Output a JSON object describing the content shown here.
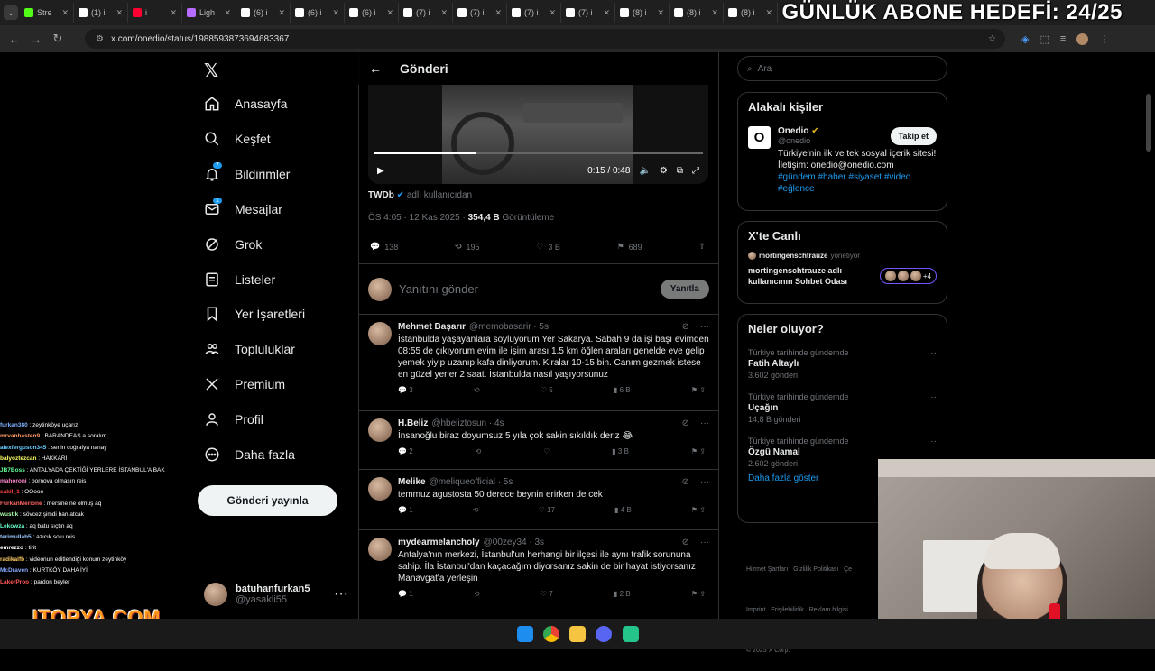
{
  "tabs": [
    {
      "label": "Stre",
      "color": "#53fc18"
    },
    {
      "label": "(1) i",
      "color": "#ffffff"
    },
    {
      "label": "i",
      "color": "#ff0033"
    },
    {
      "label": "Ligh",
      "color": "#b86bff"
    },
    {
      "label": "(6) i",
      "color": "#ffffff"
    },
    {
      "label": "(6) i",
      "color": "#ffffff"
    },
    {
      "label": "(6) i",
      "color": "#ffffff"
    },
    {
      "label": "(7) i",
      "color": "#ffffff"
    },
    {
      "label": "(7) i",
      "color": "#ffffff"
    },
    {
      "label": "(7) i",
      "color": "#ffffff"
    },
    {
      "label": "(7) i",
      "color": "#ffffff"
    },
    {
      "label": "(8) i",
      "color": "#ffffff"
    },
    {
      "label": "(8) i",
      "color": "#ffffff"
    },
    {
      "label": "(8) i",
      "color": "#ffffff"
    }
  ],
  "overlay": {
    "abone": "GÜNLÜK ABONE HEDEFİ: 24/25",
    "logo": "ITOPYA.COM"
  },
  "browser": {
    "url": "x.com/onedio/status/1988593873694683367"
  },
  "sidebar": {
    "items": [
      {
        "label": "Anasayfa",
        "icon": "home-icon"
      },
      {
        "label": "Keşfet",
        "icon": "search-icon"
      },
      {
        "label": "Bildirimler",
        "icon": "bell-icon",
        "badge": "7"
      },
      {
        "label": "Mesajlar",
        "icon": "mail-icon",
        "badge": "1"
      },
      {
        "label": "Grok",
        "icon": "grok-icon"
      },
      {
        "label": "Listeler",
        "icon": "list-icon"
      },
      {
        "label": "Yer İşaretleri",
        "icon": "bookmark-icon"
      },
      {
        "label": "Topluluklar",
        "icon": "people-icon"
      },
      {
        "label": "Premium",
        "icon": "x-icon"
      },
      {
        "label": "Profil",
        "icon": "person-icon"
      },
      {
        "label": "Daha fazla",
        "icon": "more-icon"
      }
    ],
    "post_button": "Gönderi yayınla",
    "user": {
      "name": "batuhanfurkan5",
      "handle": "@yasakli55",
      "more": "···"
    }
  },
  "main": {
    "header": "Gönderi",
    "video": {
      "time": "0:15 / 0:48"
    },
    "source": {
      "name": "TWDb",
      "suffix": "adlı kullanıcıdan"
    },
    "meta": {
      "time": "ÖS 4:05 · 12 Kas 2025 ·",
      "views": "354,4 B",
      "views_label": "Görüntüleme"
    },
    "stats": {
      "replies": "138",
      "retweets": "195",
      "likes": "3 B",
      "bookmarks": "689"
    },
    "reply_placeholder": "Yanıtını gönder",
    "reply_button": "Yanıtla",
    "tweets": [
      {
        "name": "Mehmet Başarır",
        "handle": "@memobasarir · 5s",
        "text": "İstanbulda yaşayanlara söylüyorum Yer Sakarya. Sabah 9 da işi başı evimden 08:55 de çıkıyorum evim ile işim arası 1.5 km öğlen araları genelde eve gelip yemek yiyip uzanıp kafa dinliyorum. Kiralar 10-15 bin. Canım gezmek istese en güzel yerler 2 saat. İstanbulda nasıl yaşıyorsunuz",
        "replies": "3",
        "retweets": "",
        "likes": "5",
        "views": "6 B"
      },
      {
        "name": "H.Beliz",
        "handle": "@hbeliztosun · 4s",
        "text": "İnsanoğlu biraz doyumsuz 5 yıla çok sakin sıkıldık deriz 😂",
        "replies": "2",
        "retweets": "",
        "likes": "",
        "views": "3 B"
      },
      {
        "name": "Melike",
        "handle": "@meliqueofficial · 5s",
        "text": "temmuz agustosta 50 derece beynin erirken de cek",
        "replies": "1",
        "retweets": "",
        "likes": "17",
        "views": "4 B"
      },
      {
        "name": "mydearmelancholy",
        "handle": "@00zey34 · 3s",
        "text": "Antalya'nın merkezi, İstanbul'un herhangi bir ilçesi ile aynı trafik sorununa sahip. İla İstanbul'dan kaçacağım diyorsanız sakin de bir hayat istiyorsanız Manavgat'a yerleşin",
        "replies": "1",
        "retweets": "",
        "likes": "7",
        "views": "2 B"
      }
    ]
  },
  "right": {
    "search_placeholder": "Ara",
    "related": {
      "title": "Alakalı kişiler",
      "name": "Onedio",
      "handle": "@onedio",
      "follow": "Takip et",
      "bio": "Türkiye'nin ilk ve tek sosyal içerik sitesi! İletişim: onedio@onedio.com",
      "tags": "#gündem #haber #siyaset #video #eğlence"
    },
    "live": {
      "title": "X'te Canlı",
      "host": "mortingenschtrauze",
      "host_suffix": "yönetiyor",
      "room": "mortingenschtrauze adlı kullanıcının Sohbet Odası",
      "count": "+4"
    },
    "trends": {
      "title": "Neler oluyor?",
      "items": [
        {
          "sub": "Türkiye tarihinde gündemde",
          "name": "Fatih Altaylı",
          "count": "3.602 gönderi"
        },
        {
          "sub": "Türkiye tarihinde gündemde",
          "name": "Uçağın",
          "count": "14,8 B gönderi"
        },
        {
          "sub": "Türkiye tarihinde gündemde",
          "name": "Özgü Namal",
          "count": "2.602 gönderi"
        }
      ],
      "more": "Daha fazla göster"
    },
    "footer": {
      "line1": "Hizmet Şartları   Gizlilik Politikası   Çe",
      "line2": "Imprint   Erişilebilirlik   Reklam bilgisi",
      "line3": "© 2025 X Corp."
    }
  },
  "chat": [
    {
      "user": "furkan380",
      "color": "#7fb3ff",
      "msg": "zeytinköye uçarız"
    },
    {
      "user": "mrvanbasten9",
      "color": "#ff9966",
      "msg": "BARANDEAŞ a soralım"
    },
    {
      "user": "alexferguson345",
      "color": "#66ccff",
      "msg": "senin coğrafya nanay"
    },
    {
      "user": "balyoztezcan",
      "color": "#ffff66",
      "msg": "HAKKARİ"
    },
    {
      "user": "JB7Boss",
      "color": "#66ff99",
      "msg": "ANTALYADA ÇEKTİĞİ YERLERE İSTANBUL'A BAK"
    },
    {
      "user": "mahoroni",
      "color": "#ff88cc",
      "msg": "bornova olmasın reis"
    },
    {
      "user": "sakil_1",
      "color": "#ff4444",
      "msg": "OOooo"
    },
    {
      "user": "FurkanMerione",
      "color": "#ff6666",
      "msg": "mersine ne olmuş aq"
    },
    {
      "user": "wustik",
      "color": "#aaffaa",
      "msg": "sövcez şimdi ban atcak"
    },
    {
      "user": "Lekowza",
      "color": "#66ffcc",
      "msg": "aq batu sıçtın aq"
    },
    {
      "user": "terimullah5",
      "color": "#99ccff",
      "msg": "azıcık solu reis"
    },
    {
      "user": "emrezzo",
      "color": "#ffffff",
      "msg": "tirit"
    },
    {
      "user": "radikalfb",
      "color": "#ffcc66",
      "msg": "videonun editlendiği konum zeytinköy"
    },
    {
      "user": "McDraven",
      "color": "#88aaff",
      "msg": "KURTKÖY DAHA İYİ"
    },
    {
      "user": "LakerProo",
      "color": "#ff5555",
      "msg": "pardon beyler"
    }
  ]
}
